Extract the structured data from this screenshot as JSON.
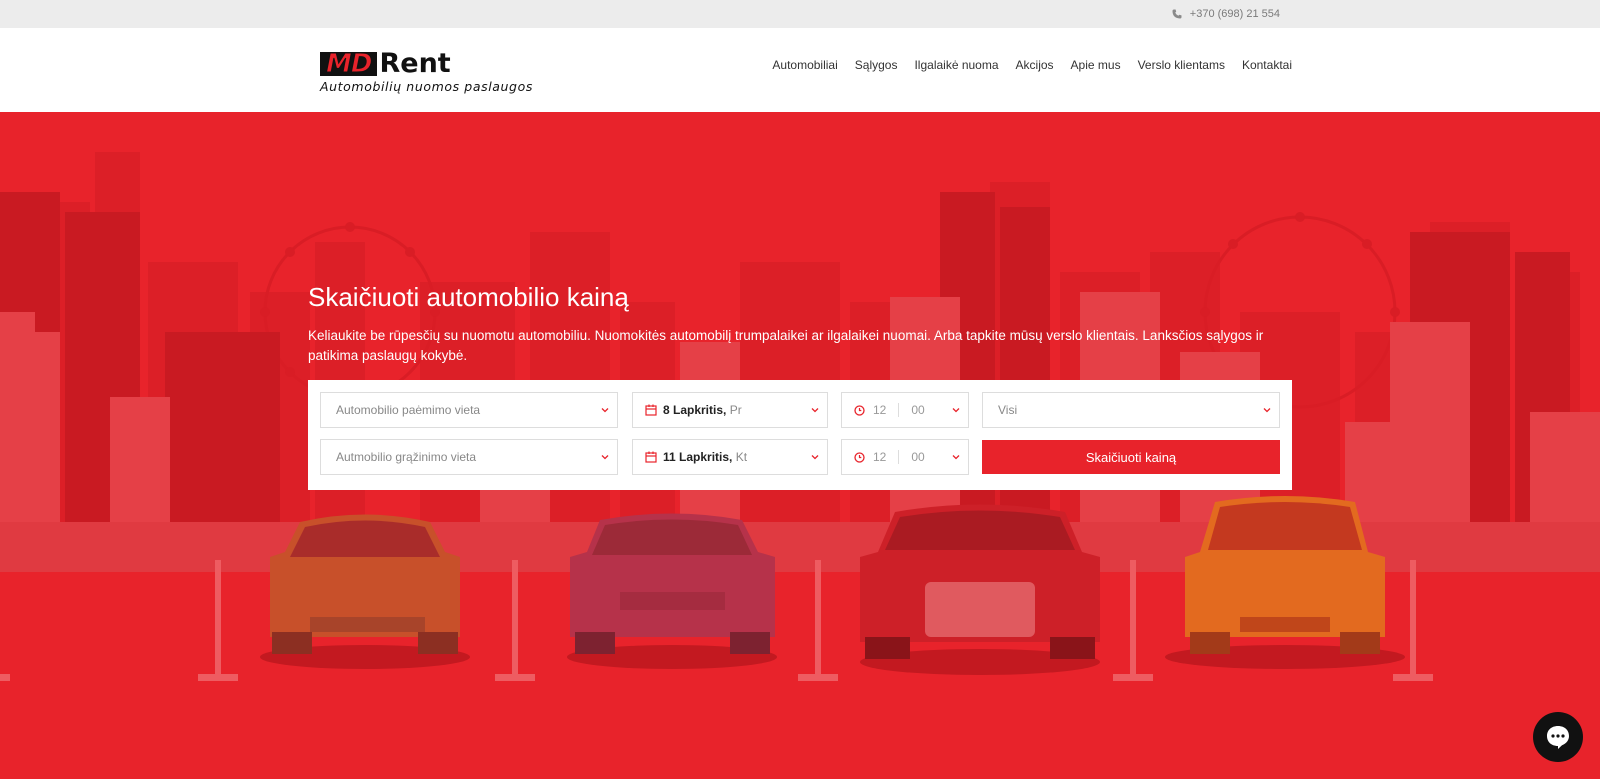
{
  "topbar": {
    "phone": "+370 (698) 21 554"
  },
  "logo": {
    "brand_md": "MD",
    "brand_rent": "Rent",
    "tagline": "Automobilių nuomos paslaugos"
  },
  "nav": [
    "Automobiliai",
    "Sąlygos",
    "Ilgalaikė nuoma",
    "Akcijos",
    "Apie mus",
    "Verslo klientams",
    "Kontaktai"
  ],
  "hero": {
    "title": "Skaičiuoti automobilio kainą",
    "text": "Keliaukite be rūpesčių su nuomotu automobiliu. Nuomokitės automobilį trumpalaikei ar ilgalaikei nuomai. Arba tapkite mūsų verslo klientais. Lanksčios sąlygos ir patikima paslaugų kokybė."
  },
  "form": {
    "pickup_location_placeholder": "Automobilio paėmimo vieta",
    "return_location_placeholder": "Autmobilio grąžinimo vieta",
    "pickup_date": "8 Lapkritis",
    "pickup_weekday": "Pr",
    "return_date": "11 Lapkritis",
    "return_weekday": "Kt",
    "pickup_hour": "12",
    "pickup_minute": "00",
    "return_hour": "12",
    "return_minute": "00",
    "category": "Visi",
    "submit_label": "Skaičiuoti kainą"
  },
  "colors": {
    "brand_red": "#e8232b",
    "dark": "#111111"
  },
  "icons": [
    "phone-icon",
    "calendar-icon",
    "clock-icon",
    "chevron-down-icon",
    "chat-icon"
  ]
}
